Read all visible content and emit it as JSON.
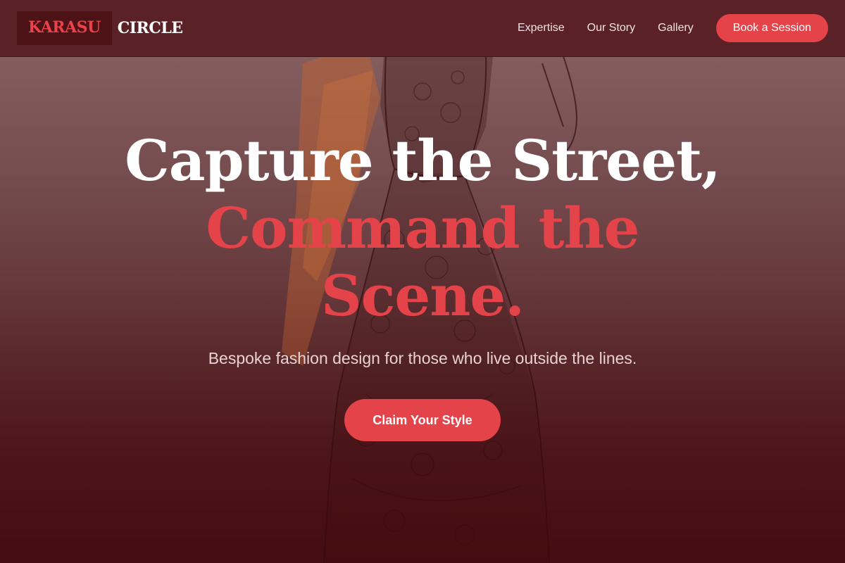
{
  "brand": {
    "name_part1": "KARASU",
    "name_part2": "CIRCLE"
  },
  "nav": {
    "links": [
      "Expertise",
      "Our Story",
      "Gallery"
    ],
    "cta_label": "Book a Session"
  },
  "hero": {
    "headline_line1": "Capture the Street,",
    "headline_accent": "Command the Scene.",
    "subheadline": "Bespoke fashion design for those who live outside the lines.",
    "cta_label": "Claim Your Style",
    "background_image": "fashion-sketch-dress-illustration"
  },
  "colors": {
    "accent": "#e5434a",
    "nav_background": "#5a2226",
    "logo_box": "#4d1215",
    "hero_dark": "#4a1217"
  }
}
